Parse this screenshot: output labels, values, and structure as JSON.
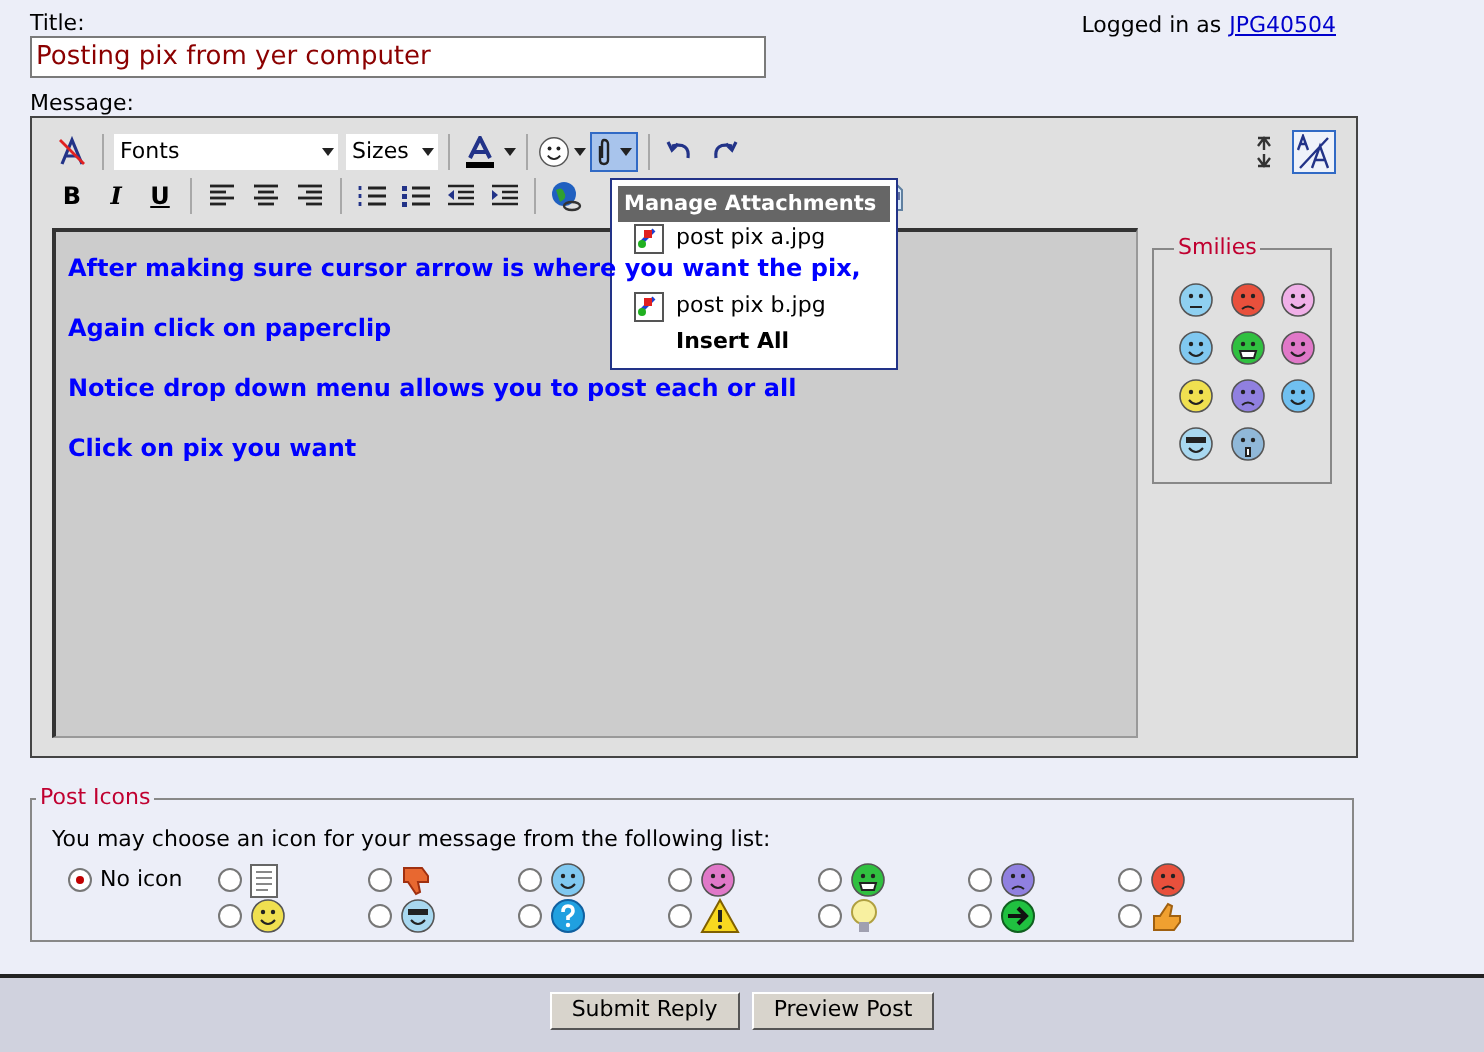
{
  "title_field": {
    "label": "Title:",
    "value": "Posting pix from yer computer"
  },
  "login": {
    "text": "Logged in as",
    "user": "JPG40504"
  },
  "message_label": "Message:",
  "toolbar": {
    "font_select": "Fonts",
    "size_select": "Sizes",
    "attach_active": true,
    "bold": "B",
    "italic": "I",
    "underline": "U"
  },
  "attachments_menu": {
    "title": "Manage Attachments",
    "items": [
      {
        "label": "post pix a.jpg",
        "kind": "file"
      },
      {
        "label": "post pix b.jpg",
        "kind": "file"
      },
      {
        "label": "Insert All",
        "kind": "action"
      }
    ]
  },
  "editor_lines": [
    "After making sure cursor arrow is where you want the pix,",
    "Again click on paperclip",
    "Notice drop down menu allows you to post each or all",
    "Click on pix you want"
  ],
  "smilies": {
    "legend": "Smilies",
    "items": [
      {
        "color": "#8fd0f0",
        "kind": "confused"
      },
      {
        "color": "#e8503c",
        "kind": "angry"
      },
      {
        "color": "#f0b0e8",
        "kind": "tongue"
      },
      {
        "color": "#80c8f0",
        "kind": "wink"
      },
      {
        "color": "#30c040",
        "kind": "grin"
      },
      {
        "color": "#e078c8",
        "kind": "happy"
      },
      {
        "color": "#f0e050",
        "kind": "happy"
      },
      {
        "color": "#9080e0",
        "kind": "sad"
      },
      {
        "color": "#70c0f0",
        "kind": "roll"
      },
      {
        "color": "#a8d8f0",
        "kind": "cool"
      },
      {
        "color": "#90b8d8",
        "kind": "shock"
      }
    ]
  },
  "post_icons": {
    "legend": "Post Icons",
    "intro": "You may choose an icon for your message from the following list:",
    "rows": [
      [
        {
          "kind": "none",
          "label": "No icon",
          "selected": true
        },
        {
          "kind": "page",
          "selected": false
        },
        {
          "kind": "thumbs-down",
          "selected": false
        },
        {
          "kind": "smiley",
          "color": "#80c8f0",
          "selected": false
        },
        {
          "kind": "smiley",
          "color": "#e078c8",
          "selected": false
        },
        {
          "kind": "grin",
          "color": "#30c040",
          "selected": false
        },
        {
          "kind": "sad",
          "color": "#9080e0",
          "selected": false
        },
        {
          "kind": "sad",
          "color": "#e8503c",
          "selected": false
        }
      ],
      [
        {
          "kind": "smiley",
          "color": "#f0e050",
          "selected": false
        },
        {
          "kind": "cool",
          "color": "#a8d8f0",
          "selected": false
        },
        {
          "kind": "question",
          "selected": false
        },
        {
          "kind": "warning",
          "selected": false
        },
        {
          "kind": "bulb",
          "selected": false
        },
        {
          "kind": "arrow",
          "selected": false
        },
        {
          "kind": "thumbs-up",
          "selected": false
        }
      ]
    ]
  },
  "buttons": [
    "Submit Reply",
    "Preview Post"
  ]
}
